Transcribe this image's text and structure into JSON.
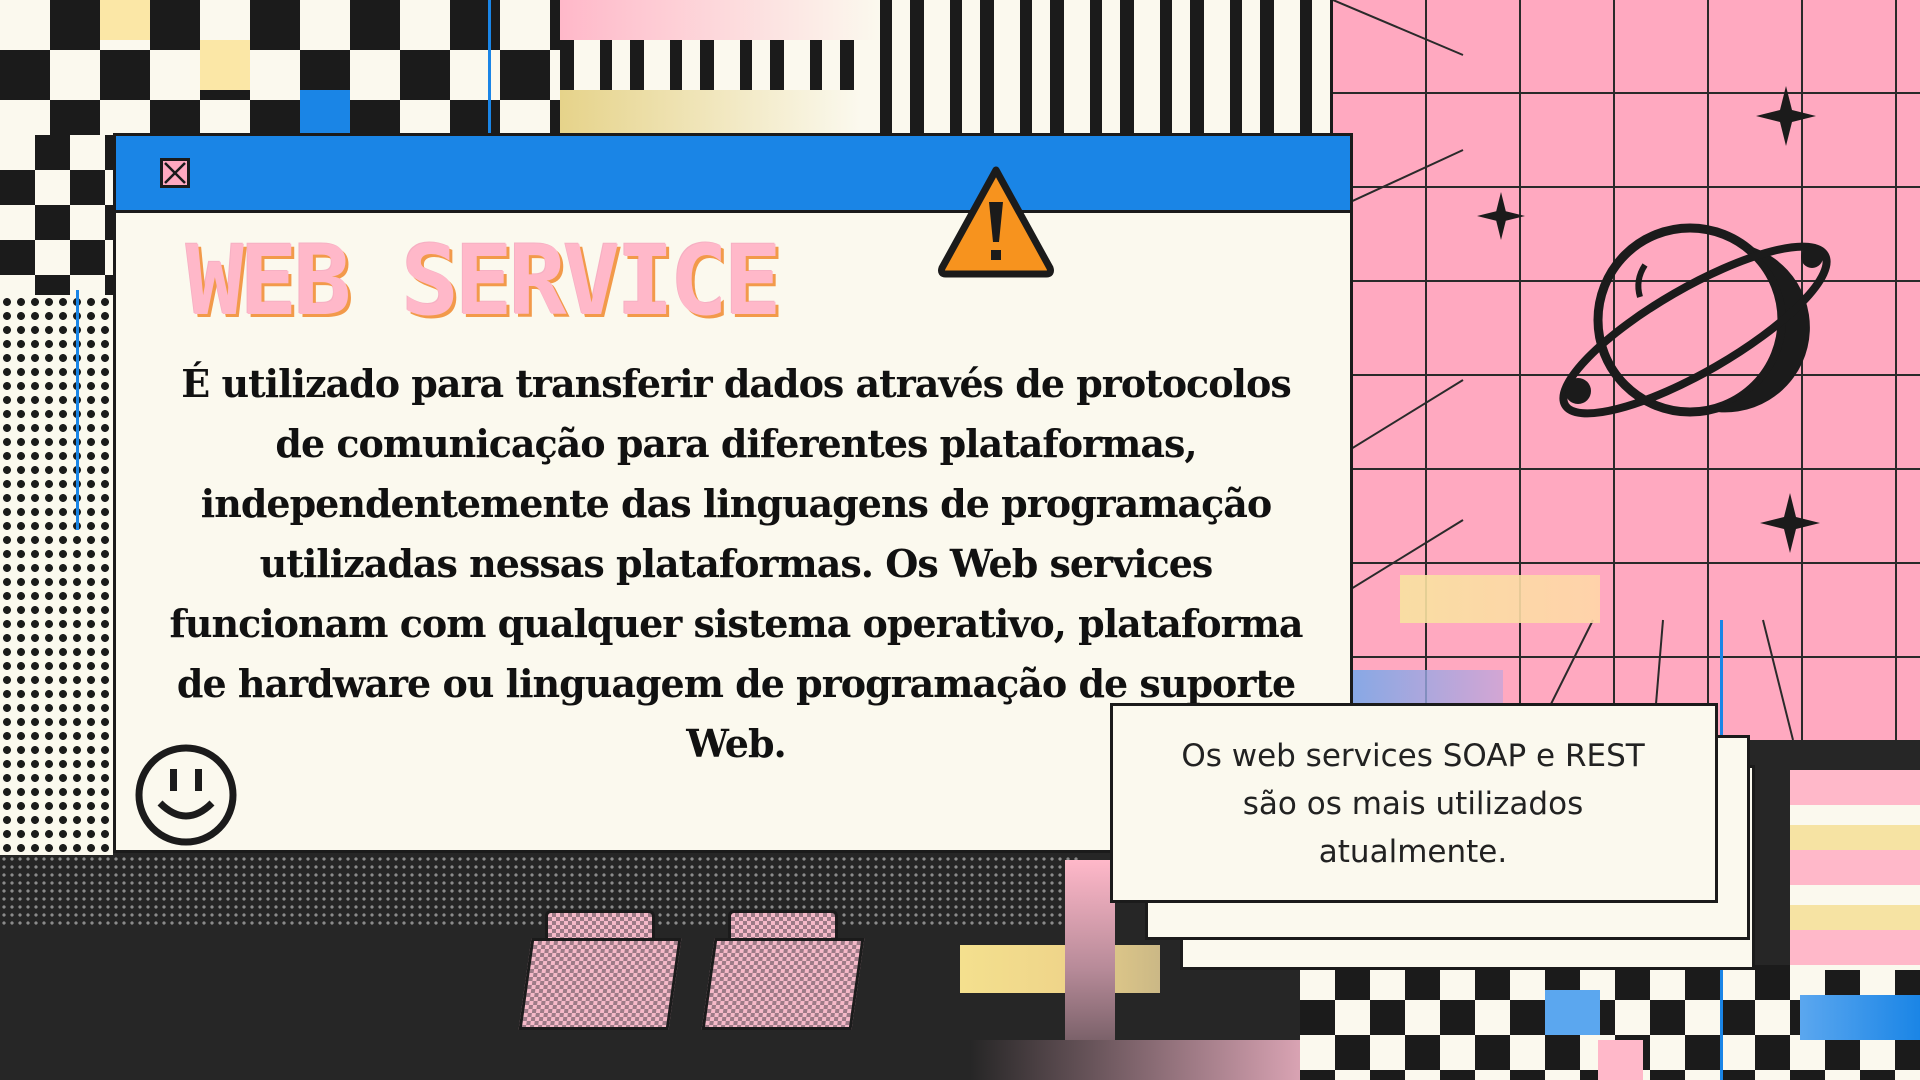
{
  "window": {
    "title_icon": "close-icon",
    "heading": "WEB SERVICE",
    "warning_icon": "warning-icon",
    "body": "É utilizado para transferir dados através de protocolos de comunicação para diferentes plataformas, independentemente das linguagens de programação utilizadas nessas plataformas. Os Web services funcionam com qualquer sistema operativo, plataforma de hardware ou linguagem de programação de suporte Web.",
    "smiley_icon": "smiley-icon"
  },
  "note": {
    "text": "Os web services SOAP e REST são os mais utilizados atualmente."
  },
  "decorations": {
    "planet_icon": "planet-icon",
    "sparkle_icon": "sparkle-icon",
    "folder_icon": "folder-icon"
  },
  "colors": {
    "titlebar": "#1a85e6",
    "window_bg": "#fbf9ee",
    "heading": "#ffb8c9",
    "grid_pink": "#ffa9c0",
    "warning": "#f7931e"
  }
}
